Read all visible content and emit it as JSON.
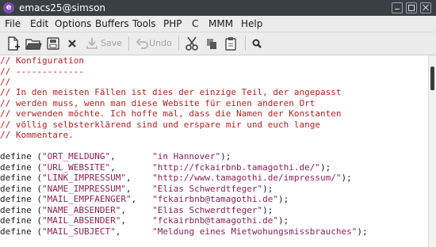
{
  "window": {
    "title": "emacs25@simson",
    "app_icon": "emacs-icon"
  },
  "menubar": {
    "items": [
      "File",
      "Edit",
      "Options",
      "Buffers",
      "Tools",
      "PHP",
      "C",
      "MMM",
      "Help"
    ]
  },
  "toolbar": {
    "buttons": [
      {
        "icon": "new-file-icon"
      },
      {
        "icon": "open-folder-icon"
      },
      {
        "icon": "dired-icon"
      },
      {
        "icon": "close-icon"
      },
      {
        "icon": "save-icon",
        "label": "Save"
      },
      {
        "icon": "undo-icon",
        "label": "Undo"
      },
      {
        "icon": "cut-icon"
      },
      {
        "icon": "copy-icon"
      },
      {
        "icon": "paste-icon"
      },
      {
        "icon": "search-icon"
      }
    ]
  },
  "editor": {
    "comment_lines": [
      "// Konfiguration",
      "// -------------",
      "//",
      "// In den meisten Fällen ist dies der einzige Teil, der angepasst",
      "// werden muss, wenn man diese Website für einen anderen Ort",
      "// verwenden möchte. Ich hoffe mal, dass die Namen der Konstanten",
      "// völlig selbsterklärend sind und erspare mir und euch lange",
      "// Kommentare."
    ],
    "define_lines": [
      {
        "kw": "define",
        "name": "\"ORT_MELDUNG\"",
        "pad": "       ",
        "value": "\"in Hannover\""
      },
      {
        "kw": "define",
        "name": "\"URL_WEBSITE\"",
        "pad": "       ",
        "value": "\"http://fckairbnb.tamagothi.de/\""
      },
      {
        "kw": "define",
        "name": "\"LINK_IMPRESSUM\"",
        "pad": "    ",
        "value": "\"http://www.tamagothi.de/impressum/\""
      },
      {
        "kw": "define",
        "name": "\"NAME_IMPRESSUM\"",
        "pad": "    ",
        "value": "\"Elias Schwerdtfeger\""
      },
      {
        "kw": "define",
        "name": "\"MAIL_EMPFAENGER\"",
        "pad": "   ",
        "value": "\"fckairbnb@tamagothi.de\""
      },
      {
        "kw": "define",
        "name": "\"NAME_ABSENDER\"",
        "pad": "     ",
        "value": "\"Elias Schwerdtfeger\""
      },
      {
        "kw": "define",
        "name": "\"MAIL_ABSENDER\"",
        "pad": "     ",
        "value": "\"fckairbnb@tamagothi.de\""
      },
      {
        "kw": "define",
        "name": "\"MAIL_SUBJECT\"",
        "pad": "      ",
        "value": "\"Meldung eines Mietwohungsmissbrauches\""
      }
    ]
  },
  "colors": {
    "comment": "#b22222",
    "string": "#8b2252",
    "titlebar": "#3a3f44",
    "chrome": "#ececec"
  }
}
